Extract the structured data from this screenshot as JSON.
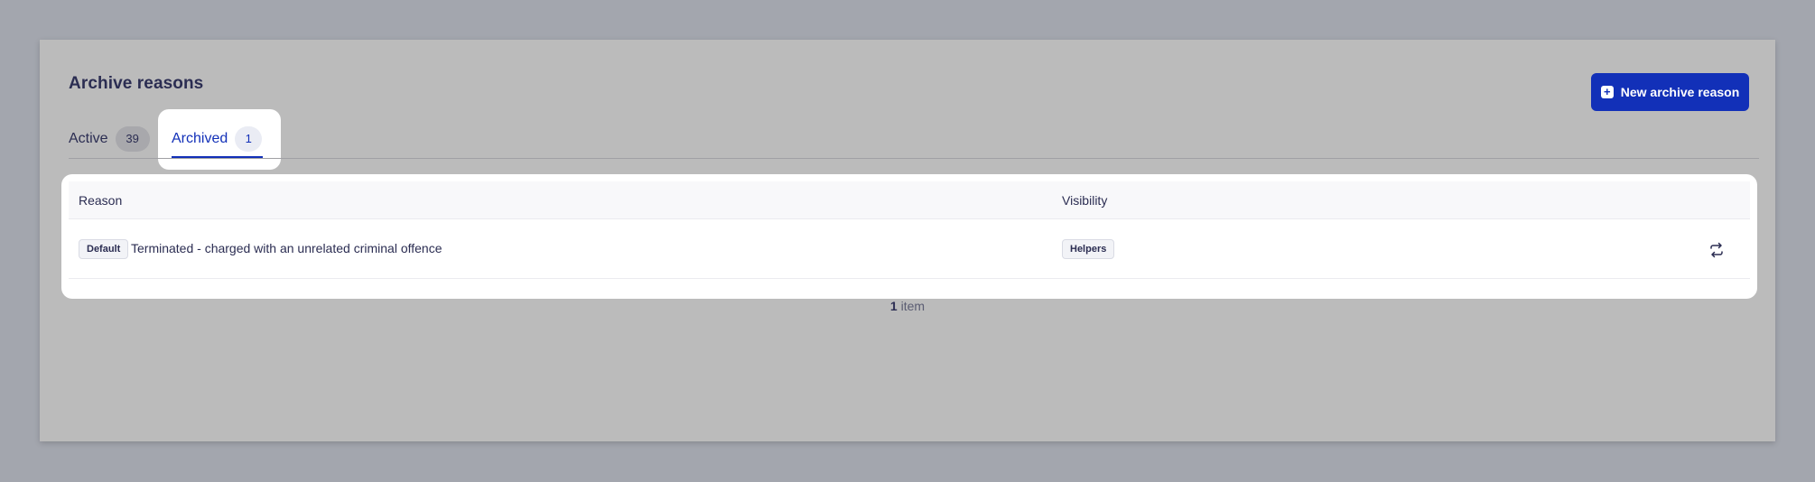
{
  "page": {
    "title": "Archive reasons",
    "new_button_label": "New archive reason",
    "accent_color": "#1230b8"
  },
  "tabs": [
    {
      "label": "Active",
      "count": "39",
      "selected": false
    },
    {
      "label": "Archived",
      "count": "1",
      "selected": true
    }
  ],
  "table": {
    "columns": {
      "reason": "Reason",
      "visibility": "Visibility"
    },
    "rows": [
      {
        "badge": "Default",
        "reason": "Terminated - charged with an unrelated criminal offence",
        "visibility": "Helpers",
        "action_icon": "restore-icon"
      }
    ]
  },
  "footer": {
    "count": "1",
    "count_label": "item"
  }
}
